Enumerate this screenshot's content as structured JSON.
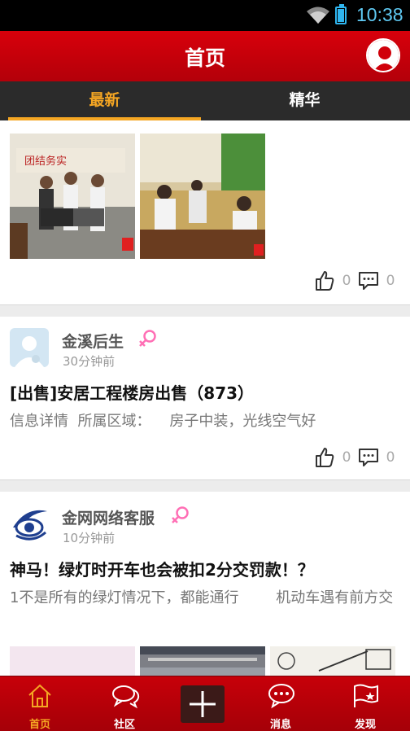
{
  "status_bar": {
    "time": "10:38"
  },
  "header": {
    "title": "首页"
  },
  "tabs": [
    {
      "label": "最新",
      "active": true
    },
    {
      "label": "精华",
      "active": false
    }
  ],
  "posts": [
    {
      "likes": "0",
      "comments": "0"
    },
    {
      "author": "金溪后生",
      "time": "30分钟前",
      "title": "[出售]安居工程楼房出售（873）",
      "description": "信息详情  所属区域：    房子中装，光线空气好",
      "likes": "0",
      "comments": "0"
    },
    {
      "author": "金网网络客服",
      "time": "10分钟前",
      "title": "神马！绿灯时开车也会被扣2分交罚款！？",
      "description": "1不是所有的绿灯情况下，都能通行        机动车遇有前方交"
    }
  ],
  "bottom_nav": [
    {
      "label": "首页",
      "icon": "home-icon",
      "active": true
    },
    {
      "label": "社区",
      "icon": "chat-bubbles-icon",
      "active": false
    },
    {
      "label": "",
      "icon": "plus-icon",
      "active": false
    },
    {
      "label": "消息",
      "icon": "message-icon",
      "active": false
    },
    {
      "label": "发现",
      "icon": "discover-flag-icon",
      "active": false
    }
  ],
  "colors": {
    "brand_red": "#c8000a",
    "accent_orange": "#f5a623",
    "female_pink": "#ff6fb5"
  }
}
